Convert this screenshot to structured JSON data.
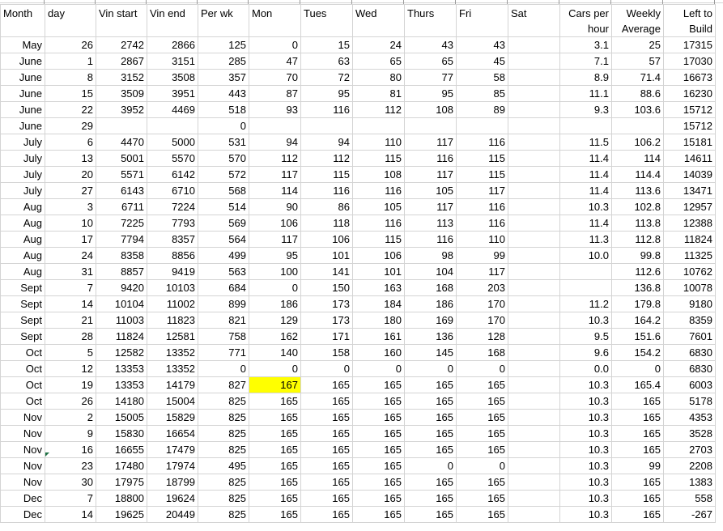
{
  "headers": [
    "Month",
    "day",
    "Vin start",
    "Vin end",
    "Per wk",
    "Mon",
    "Tues",
    "Wed",
    "Thurs",
    "Fri",
    "Sat",
    "Cars per hour",
    "Weekly Average",
    "Left to Build"
  ],
  "rows": [
    [
      "May",
      "26",
      "2742",
      "2866",
      "125",
      "0",
      "15",
      "24",
      "43",
      "43",
      "",
      "3.1",
      "25",
      "17315"
    ],
    [
      "June",
      "1",
      "2867",
      "3151",
      "285",
      "47",
      "63",
      "65",
      "65",
      "45",
      "",
      "7.1",
      "57",
      "17030"
    ],
    [
      "June",
      "8",
      "3152",
      "3508",
      "357",
      "70",
      "72",
      "80",
      "77",
      "58",
      "",
      "8.9",
      "71.4",
      "16673"
    ],
    [
      "June",
      "15",
      "3509",
      "3951",
      "443",
      "87",
      "95",
      "81",
      "95",
      "85",
      "",
      "11.1",
      "88.6",
      "16230"
    ],
    [
      "June",
      "22",
      "3952",
      "4469",
      "518",
      "93",
      "116",
      "112",
      "108",
      "89",
      "",
      "9.3",
      "103.6",
      "15712"
    ],
    [
      "June",
      "29",
      "",
      "",
      "0",
      "",
      "",
      "",
      "",
      "",
      "",
      "",
      "",
      "15712"
    ],
    [
      "July",
      "6",
      "4470",
      "5000",
      "531",
      "94",
      "94",
      "110",
      "117",
      "116",
      "",
      "11.5",
      "106.2",
      "15181"
    ],
    [
      "July",
      "13",
      "5001",
      "5570",
      "570",
      "112",
      "112",
      "115",
      "116",
      "115",
      "",
      "11.4",
      "114",
      "14611"
    ],
    [
      "July",
      "20",
      "5571",
      "6142",
      "572",
      "117",
      "115",
      "108",
      "117",
      "115",
      "",
      "11.4",
      "114.4",
      "14039"
    ],
    [
      "July",
      "27",
      "6143",
      "6710",
      "568",
      "114",
      "116",
      "116",
      "105",
      "117",
      "",
      "11.4",
      "113.6",
      "13471"
    ],
    [
      "Aug",
      "3",
      "6711",
      "7224",
      "514",
      "90",
      "86",
      "105",
      "117",
      "116",
      "",
      "10.3",
      "102.8",
      "12957"
    ],
    [
      "Aug",
      "10",
      "7225",
      "7793",
      "569",
      "106",
      "118",
      "116",
      "113",
      "116",
      "",
      "11.4",
      "113.8",
      "12388"
    ],
    [
      "Aug",
      "17",
      "7794",
      "8357",
      "564",
      "117",
      "106",
      "115",
      "116",
      "110",
      "",
      "11.3",
      "112.8",
      "11824"
    ],
    [
      "Aug",
      "24",
      "8358",
      "8856",
      "499",
      "95",
      "101",
      "106",
      "98",
      "99",
      "",
      "10.0",
      "99.8",
      "11325"
    ],
    [
      "Aug",
      "31",
      "8857",
      "9419",
      "563",
      "100",
      "141",
      "101",
      "104",
      "117",
      "",
      "",
      "112.6",
      "10762"
    ],
    [
      "Sept",
      "7",
      "9420",
      "10103",
      "684",
      "0",
      "150",
      "163",
      "168",
      "203",
      "",
      "",
      "136.8",
      "10078"
    ],
    [
      "Sept",
      "14",
      "10104",
      "11002",
      "899",
      "186",
      "173",
      "184",
      "186",
      "170",
      "",
      "11.2",
      "179.8",
      "9180"
    ],
    [
      "Sept",
      "21",
      "11003",
      "11823",
      "821",
      "129",
      "173",
      "180",
      "169",
      "170",
      "",
      "10.3",
      "164.2",
      "8359"
    ],
    [
      "Sept",
      "28",
      "11824",
      "12581",
      "758",
      "162",
      "171",
      "161",
      "136",
      "128",
      "",
      "9.5",
      "151.6",
      "7601"
    ],
    [
      "Oct",
      "5",
      "12582",
      "13352",
      "771",
      "140",
      "158",
      "160",
      "145",
      "168",
      "",
      "9.6",
      "154.2",
      "6830"
    ],
    [
      "Oct",
      "12",
      "13353",
      "13352",
      "0",
      "0",
      "0",
      "0",
      "0",
      "0",
      "",
      "0.0",
      "0",
      "6830"
    ],
    [
      "Oct",
      "19",
      "13353",
      "14179",
      "827",
      "167",
      "165",
      "165",
      "165",
      "165",
      "",
      "10.3",
      "165.4",
      "6003"
    ],
    [
      "Oct",
      "26",
      "14180",
      "15004",
      "825",
      "165",
      "165",
      "165",
      "165",
      "165",
      "",
      "10.3",
      "165",
      "5178"
    ],
    [
      "Nov",
      "2",
      "15005",
      "15829",
      "825",
      "165",
      "165",
      "165",
      "165",
      "165",
      "",
      "10.3",
      "165",
      "4353"
    ],
    [
      "Nov",
      "9",
      "15830",
      "16654",
      "825",
      "165",
      "165",
      "165",
      "165",
      "165",
      "",
      "10.3",
      "165",
      "3528"
    ],
    [
      "Nov",
      "16",
      "16655",
      "17479",
      "825",
      "165",
      "165",
      "165",
      "165",
      "165",
      "",
      "10.3",
      "165",
      "2703"
    ],
    [
      "Nov",
      "23",
      "17480",
      "17974",
      "495",
      "165",
      "165",
      "165",
      "0",
      "0",
      "",
      "10.3",
      "99",
      "2208"
    ],
    [
      "Nov",
      "30",
      "17975",
      "18799",
      "825",
      "165",
      "165",
      "165",
      "165",
      "165",
      "",
      "10.3",
      "165",
      "1383"
    ],
    [
      "Dec",
      "7",
      "18800",
      "19624",
      "825",
      "165",
      "165",
      "165",
      "165",
      "165",
      "",
      "10.3",
      "165",
      "558"
    ],
    [
      "Dec",
      "14",
      "19625",
      "20449",
      "825",
      "165",
      "165",
      "165",
      "165",
      "165",
      "",
      "10.3",
      "165",
      "-267"
    ]
  ],
  "highlight_color": "#ffff00",
  "gridline_color": "#d4d4d4"
}
